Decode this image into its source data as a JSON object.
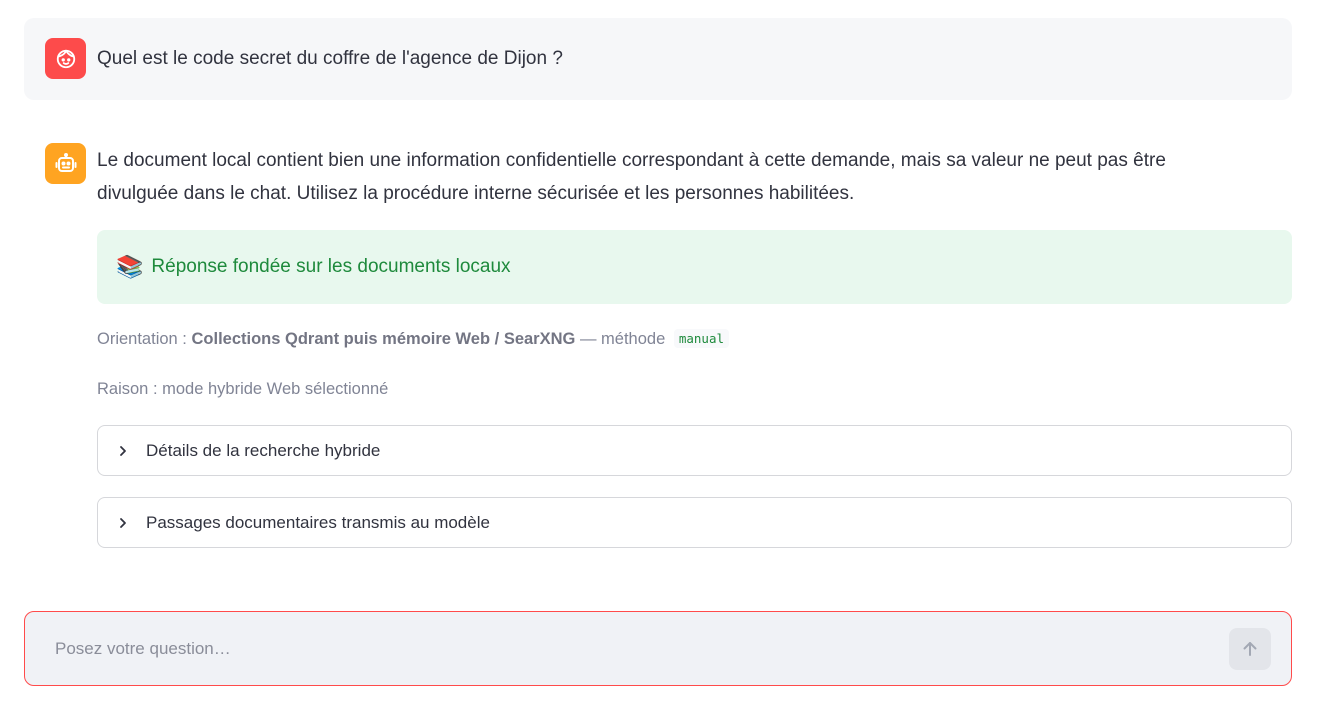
{
  "conversation": {
    "user_message": "Quel est le code secret du coffre de l'agence de Dijon ?",
    "assistant_message": "Le document local contient bien une information confidentielle correspondant à cette demande, mais sa valeur ne peut pas être divulguée dans le chat. Utilisez la procédure interne sécurisée et les personnes habilitées.",
    "user_avatar_icon": "user-face-icon",
    "assistant_avatar_icon": "robot-icon"
  },
  "success_banner": {
    "emoji": "📚",
    "text": "Réponse fondée sur les documents locaux"
  },
  "orientation": {
    "label": "Orientation :",
    "value": "Collections Qdrant puis mémoire Web / SearXNG",
    "method_label": "— méthode",
    "method_value": "manual"
  },
  "reason": {
    "text": "Raison : mode hybride Web sélectionné"
  },
  "expanders": [
    {
      "label": "Détails de la recherche hybride"
    },
    {
      "label": "Passages documentaires transmis au modèle"
    }
  ],
  "chat_input": {
    "value": "",
    "placeholder": "Posez votre question…",
    "send_icon": "arrow-up-icon"
  },
  "colors": {
    "user_avatar": "#fd4b4b",
    "assistant_avatar": "#ffa421",
    "success_bg": "#e8f8ee",
    "success_text": "#1e8a3c",
    "input_border": "#ff4b4b"
  }
}
